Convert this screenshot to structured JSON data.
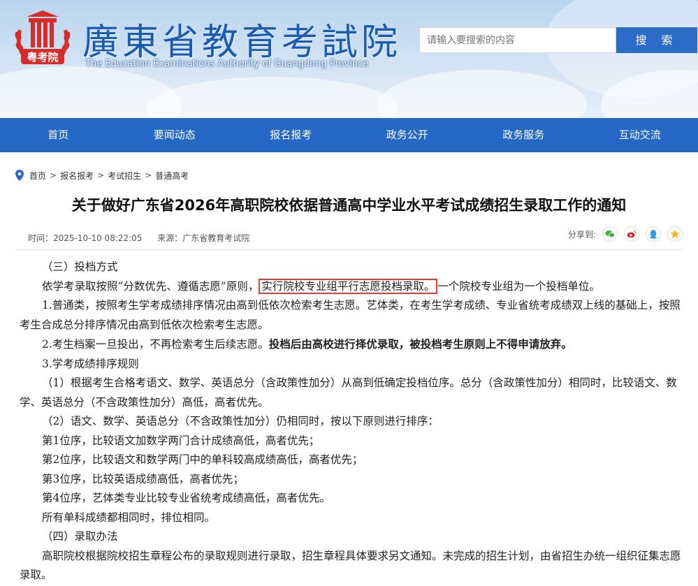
{
  "header": {
    "title_cn": "廣東省教育考試院",
    "title_en": "The Education Examinations Authority of Guangdong Province",
    "logo_text": "粤考院",
    "search_placeholder": "请输入要搜索的内容",
    "search_button": "搜 索",
    "brand_color": "#2567c4",
    "logo_color": "#d62c2c"
  },
  "nav": {
    "items": [
      "首页",
      "要闻动态",
      "报名报考",
      "政务公开",
      "政务服务",
      "互动交流"
    ]
  },
  "breadcrumb": [
    "首页",
    "报名报考",
    "考试招生",
    "普通高考"
  ],
  "breadcrumb_sep": ">",
  "article": {
    "title": "关于做好广东省2026年高职院校依据普通高中学业水平考试成绩招生录取工作的通知",
    "time": "时间：2025-10-10 08:22:05",
    "source": "来源：广东省教育考试院",
    "share_label": "分享到:",
    "paragraphs": {
      "p1": "（三）投档方式",
      "p2_before": "依学考录取按照“分数优先、遵循志愿”原则，",
      "p2_highlight": "实行院校专业组平行志愿投档录取。",
      "p2_after": "一个院校专业组为一个投档单位。",
      "p3": "1.普通类，按照考生学考成绩排序情况由高到低依次检索考生志愿。艺体类，在考生学考成绩、专业省统考成绩双上线的基础上，按照考生合成总分排序情况由高到低依次检索考生志愿。",
      "p4_normal": "2.考生档案一旦投出，不再检索考生后续志愿。",
      "p4_bold": "投档后由高校进行择优录取，被投档考生原则上不得申请放弃。",
      "p5": "3.学考成绩排序规则",
      "p6": "（1）根据考生合格考语文、数学、英语总分（含政策性加分）从高到低确定投档位序。总分（含政策性加分）相同时，比较语文、数学、英语总分（不含政策性加分）高低，高者优先。",
      "p7": "（2）语文、数学、英语总分（不含政策性加分）仍相同时，按以下原则进行排序：",
      "p8": "第1位序，比较语文加数学两门合计成绩高低，高者优先；",
      "p9": "第2位序，比较语文和数学两门中的单科较高成绩高低，高者优先；",
      "p10": "第3位序，比较英语成绩高低，高者优先；",
      "p11": "第4位序，艺体类专业比较专业省统考成绩高低，高者优先。",
      "p12": "所有单科成绩都相同时，排位相同。",
      "p13": "（四）录取办法",
      "p14": "高职院校根据院校招生章程公布的录取规则进行录取，招生章程具体要求另文通知。未完成的招生计划，由省招生办统一组织征集志愿录取。"
    }
  },
  "icons": {
    "location": "location-pin-icon",
    "share": [
      "wechat-icon",
      "weibo-icon",
      "qq-icon",
      "qzone-icon"
    ]
  },
  "colors": {
    "highlight_border": "#e03c3c",
    "wechat": "#3db13d",
    "weibo": "#e6162d",
    "qq": "#2a9fd8",
    "qzone": "#f5b91b"
  }
}
